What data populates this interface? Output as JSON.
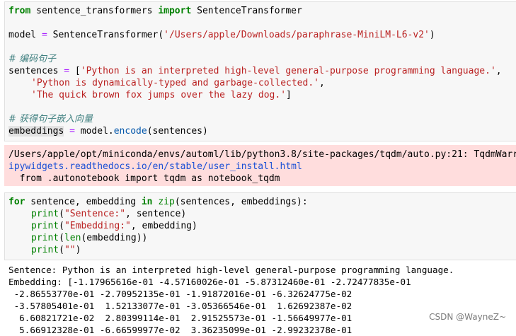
{
  "cell1": {
    "l1_from": "from",
    "l1_mod": " sentence_transformers ",
    "l1_import": "import",
    "l1_cls": " SentenceTransformer",
    "l3_a": "model ",
    "l3_eq": "=",
    "l3_b": " SentenceTransformer(",
    "l3_str": "'/Users/apple/Downloads/paraphrase-MiniLM-L6-v2'",
    "l3_c": ")",
    "l5_comment": "# 编码句子",
    "l6_a": "sentences ",
    "l6_eq": "=",
    "l6_b": " [",
    "l6_str": "'Python is an interpreted high-level general-purpose programming language.'",
    "l6_c": ",",
    "l7_str": "'Python is dynamically-typed and garbage-collected.'",
    "l7_c": ",",
    "l8_str": "'The quick brown fox jumps over the lazy dog.'",
    "l8_c": "]",
    "l10_comment": "# 获得句子嵌入向量",
    "l11_a": "embeddings",
    "l11_eq": " = ",
    "l11_b": "model.",
    "l11_call": "encode",
    "l11_c": "(sentences)"
  },
  "stderr": {
    "line1": "/Users/apple/opt/miniconda/envs/automl/lib/python3.8/site-packages/tqdm/auto.py:21: TqdmWarr",
    "link": "ipywidgets.readthedocs.io/en/stable/user_install.html",
    "line3": "  from .autonotebook import tqdm as notebook_tqdm"
  },
  "cell2": {
    "for": "for",
    "l1_a": " sentence, embedding ",
    "in": "in",
    "l1_sp": " ",
    "zip": "zip",
    "l1_b": "(sentences, embeddings):",
    "print": "print",
    "s1": "\"Sentence:\"",
    "r1": ", sentence)",
    "s2": "\"Embedding:\"",
    "r2": ", embedding)",
    "len": "len",
    "r3": "(embedding))",
    "s4": "\"\"",
    "r4": ")"
  },
  "output": {
    "lines": [
      "Sentence: Python is an interpreted high-level general-purpose programming language.",
      "Embedding: [-1.17965616e-01 -4.57160026e-01 -5.87312460e-01 -2.72477835e-01",
      " -2.86553770e-01 -2.70952135e-01 -1.91872016e-01 -6.32624775e-02",
      " -3.57805401e-01  1.52133077e-01 -3.05366546e-01  1.62692387e-02",
      "  6.60821721e-02  2.80399114e-01  2.91525573e-01 -1.56649977e-01",
      "  5.66912328e-01 -6.66599977e-02  3.36235099e-01 -2.99232378e-01"
    ]
  },
  "watermark": "CSDN @WayneZ~"
}
